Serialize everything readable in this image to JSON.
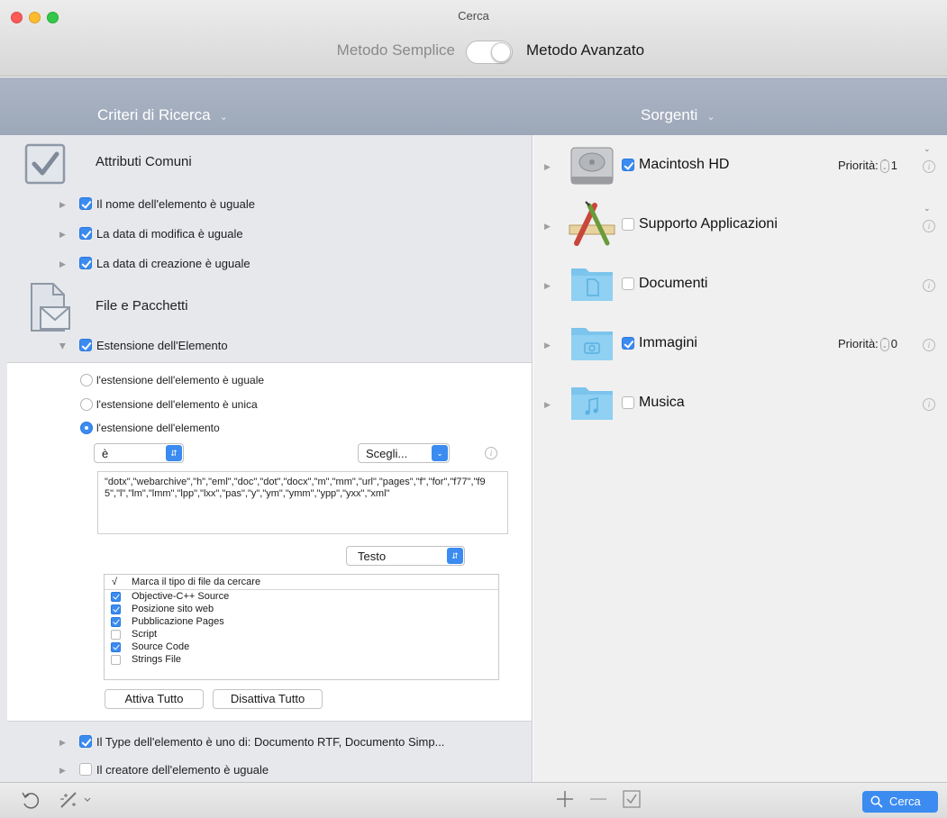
{
  "window": {
    "title": "Cerca"
  },
  "mode": {
    "simple_label": "Metodo Semplice",
    "advanced_label": "Metodo Avanzato"
  },
  "headers": {
    "criteria": "Criteri di Ricerca",
    "sources": "Sorgenti"
  },
  "common": {
    "title": "Attributi Comuni",
    "items": [
      {
        "label": "Il nome dell'elemento è uguale",
        "checked": true
      },
      {
        "label": "La data di modifica è uguale",
        "checked": true
      },
      {
        "label": "La data di creazione è uguale",
        "checked": true
      }
    ]
  },
  "files": {
    "title": "File e Pacchetti",
    "extension_label": "Estensione dell'Elemento",
    "radios": [
      {
        "label": "l'estensione dell'elemento è uguale",
        "selected": false
      },
      {
        "label": "l'estensione dell'elemento è unica",
        "selected": false
      },
      {
        "label": "l'estensione dell'elemento",
        "selected": true
      }
    ],
    "operator": "è",
    "choose_label": "Scegli...",
    "extensions_text": "\"dotx\",\"webarchive\",\"h\",\"eml\",\"doc\",\"dot\",\"docx\",\"m\",\"mm\",\"url\",\"pages\",\"f\",\"for\",\"f77\",\"f95\",\"l\",\"lm\",\"lmm\",\"lpp\",\"lxx\",\"pas\",\"y\",\"ym\",\"ymm\",\"ypp\",\"yxx\",\"xml\"",
    "category": "Testo",
    "list_header_mark": "√",
    "list_header_label": "Marca il tipo di file da cercare",
    "types": [
      {
        "label": "Objective-C++ Source",
        "checked": true
      },
      {
        "label": "Posizione sito web",
        "checked": true
      },
      {
        "label": "Pubblicazione Pages",
        "checked": true
      },
      {
        "label": "Script",
        "checked": false
      },
      {
        "label": "Source Code",
        "checked": true
      },
      {
        "label": "Strings File",
        "checked": false
      }
    ],
    "activate_all": "Attiva Tutto",
    "deactivate_all": "Disattiva Tutto"
  },
  "more_criteria": [
    {
      "label": "Il Type dell'elemento è uno di: Documento RTF, Documento Simp...",
      "checked": true
    },
    {
      "label": "Il creatore dell'elemento è uguale",
      "checked": false
    }
  ],
  "sources": [
    {
      "label": "Macintosh HD",
      "checked": true,
      "priority_label": "Priorità:",
      "priority": "1",
      "icon": "hard-drive-icon"
    },
    {
      "label": "Supporto Applicazioni",
      "checked": false,
      "icon": "applications-folder-icon"
    },
    {
      "label": "Documenti",
      "checked": false,
      "icon": "documents-folder-icon"
    },
    {
      "label": "Immagini",
      "checked": true,
      "priority_label": "Priorità:",
      "priority": "0",
      "icon": "pictures-folder-icon"
    },
    {
      "label": "Musica",
      "checked": false,
      "icon": "music-folder-icon"
    }
  ],
  "bottom": {
    "search_label": "Cerca"
  },
  "colors": {
    "accent": "#3b8bf1",
    "band": "#a3adbf"
  }
}
